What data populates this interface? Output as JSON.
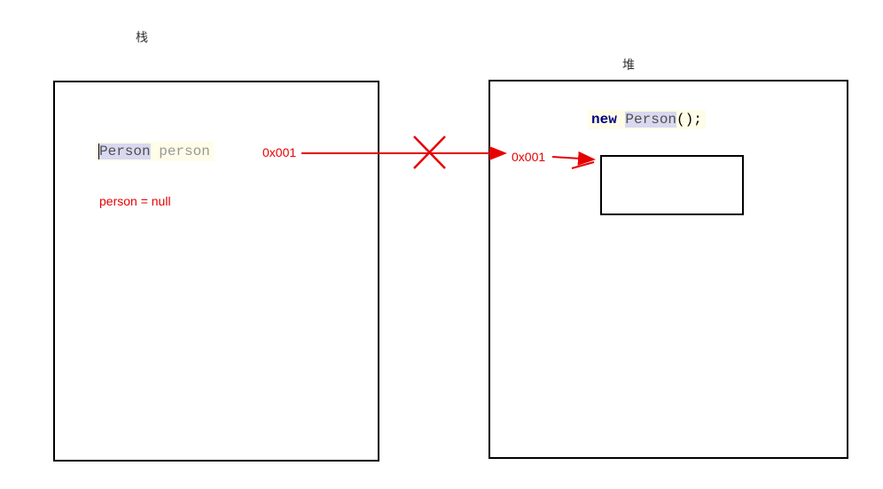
{
  "labels": {
    "stack": "栈",
    "heap": "堆"
  },
  "stack": {
    "code": {
      "type": "Person",
      "variable": "person"
    },
    "address": "0x001",
    "null_assignment": "person = null"
  },
  "heap": {
    "code": {
      "keyword": "new",
      "type": "Person",
      "suffix": "();"
    },
    "address": "0x001"
  }
}
